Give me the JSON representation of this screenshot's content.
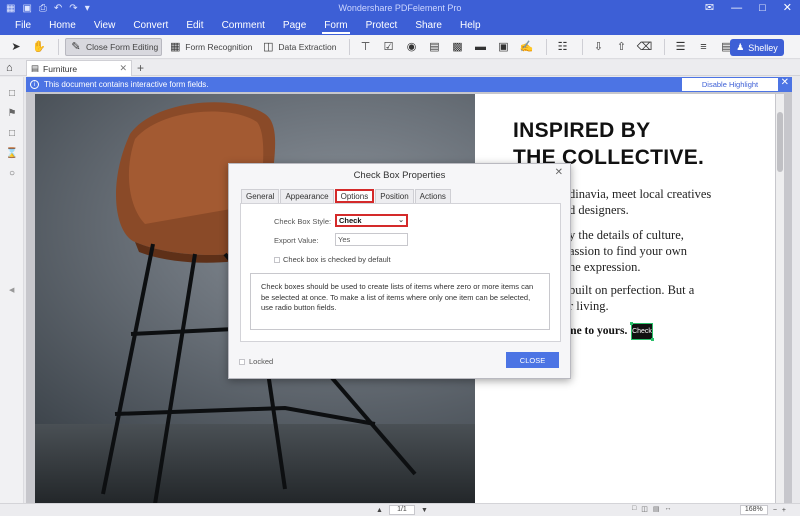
{
  "window": {
    "title": "Wondershare PDFelement Pro"
  },
  "menu": {
    "items": [
      "File",
      "Home",
      "View",
      "Convert",
      "Edit",
      "Comment",
      "Page",
      "Form",
      "Protect",
      "Share",
      "Help"
    ],
    "active": "Form"
  },
  "toolbar": {
    "close_form_editing": "Close Form Editing",
    "form_recognition": "Form Recognition",
    "data_extraction": "Data Extraction",
    "user_name": "Shelley"
  },
  "tabs": {
    "document_tab": "Furniture",
    "add": "+"
  },
  "infobar": {
    "message": "This document contains interactive form fields.",
    "disable_highlight": "Disable Highlight"
  },
  "page": {
    "headline_line1": "INSPIRED BY",
    "headline_line2": "THE COLLECTIVE.",
    "para1_line1": "dinavia, meet local creatives",
    "para1_line2": "d designers.",
    "para2_line1": "y the details of culture,",
    "para2_line2": "assion to find your own",
    "para2_line3": "ne expression.",
    "para3_line1": "built on perfection. But a",
    "para3_line2": "r living.",
    "welcome": "me to yours.",
    "check_field": "Check"
  },
  "dialog": {
    "title": "Check Box Properties",
    "tabs": [
      "General",
      "Appearance",
      "Options",
      "Position",
      "Actions"
    ],
    "active_tab": "Options",
    "style_label": "Check Box Style:",
    "style_value": "Check",
    "export_label": "Export Value:",
    "export_value": "Yes",
    "default_checked_label": "Check box is checked by default",
    "description": "Check boxes should be used to create lists of items where zero or more items can be selected at once. To make a list of items where only one item can be selected, use radio button fields.",
    "locked_label": "Locked",
    "close_label": "CLOSE"
  },
  "status": {
    "page_value": "1",
    "page_total": "/1",
    "zoom": "168%"
  },
  "colors": {
    "brand_blue": "#3d5fd6",
    "highlight_red": "#d42a2a",
    "field_green": "#2bbf6a"
  }
}
